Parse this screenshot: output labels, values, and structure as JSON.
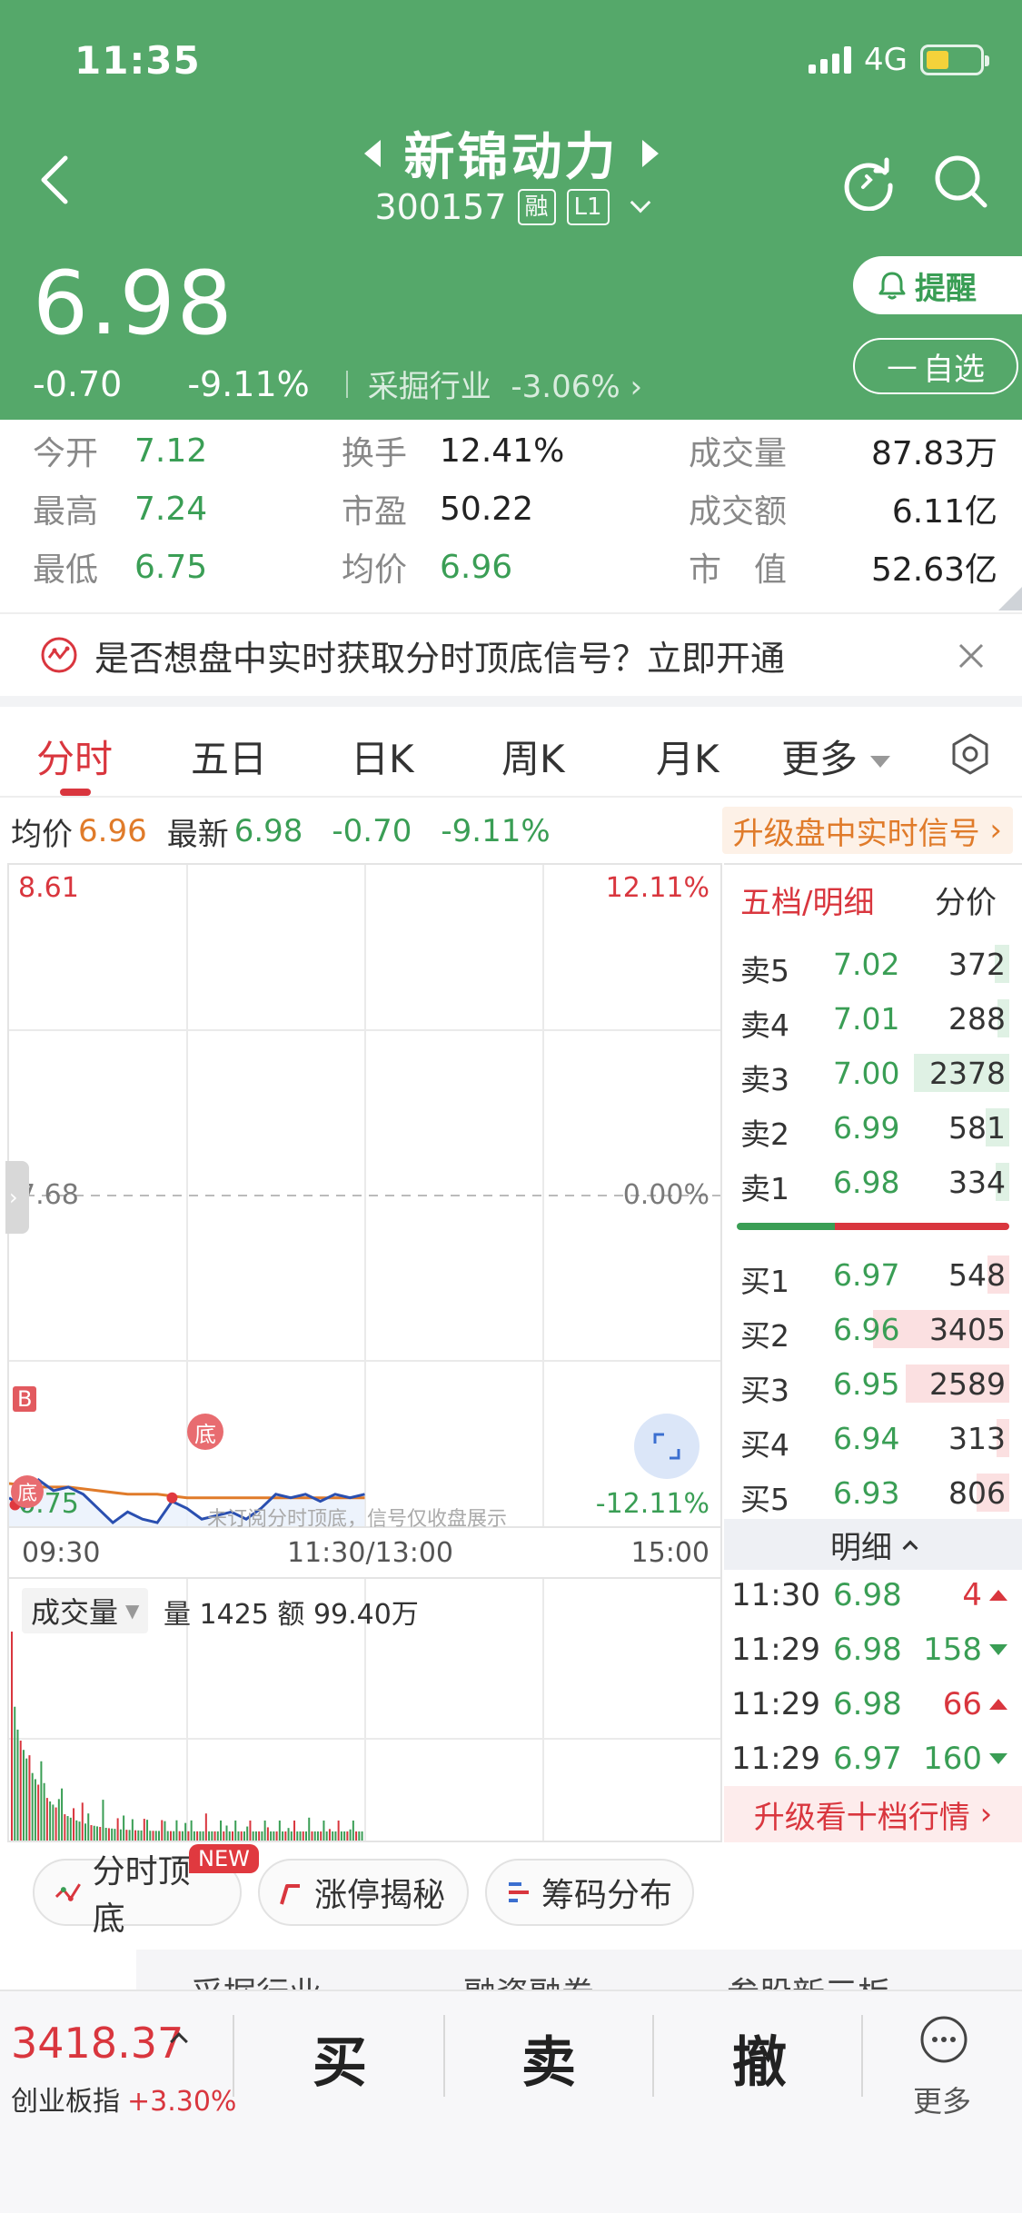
{
  "status_bar": {
    "time": "11:35",
    "network": "4G"
  },
  "header": {
    "name": "新锦动力",
    "code": "300157",
    "tag_margin": "融",
    "tag_level": "L1",
    "price": "6.98",
    "change": "-0.70",
    "change_pct": "-9.11%",
    "industry": "采掘行业",
    "industry_change": "-3.06%",
    "remind_label": "提醒",
    "watchlist_label": "自选"
  },
  "quote": {
    "open_label": "今开",
    "open": "7.12",
    "high_label": "最高",
    "high": "7.24",
    "low_label": "最低",
    "low": "6.75",
    "turnover_label": "换手",
    "turnover": "12.41%",
    "pe_label": "市盈",
    "pe": "50.22",
    "avg_label": "均价",
    "avg": "6.96",
    "volume_label": "成交量",
    "volume": "87.83万",
    "amount_label": "成交额",
    "amount": "6.11亿",
    "mcap_label": "市　值",
    "mcap": "52.63亿"
  },
  "banner": {
    "text": "是否想盘中实时获取分时顶底信号？立即开通"
  },
  "tabs": [
    "分时",
    "五日",
    "日K",
    "周K",
    "月K",
    "更多"
  ],
  "info_row": {
    "avg_label": "均价",
    "avg": "6.96",
    "latest_label": "最新",
    "latest": "6.98",
    "change": "-0.70",
    "change_pct": "-9.11%",
    "upgrade": "升级盘中实时信号"
  },
  "chart": {
    "y_top": "8.61",
    "y_mid": "7.68",
    "y_bottom": "6.75",
    "pct_top": "12.11%",
    "pct_mid": "0.00%",
    "pct_bottom": "-12.11%",
    "time_start": "09:30",
    "time_mid": "11:30/13:00",
    "time_end": "15:00",
    "marker_buy": "B",
    "marker_bottom": "底",
    "watermark": "未订阅分时顶底，信号仅收盘展示",
    "volume_tag": "成交量",
    "volume_info": "量 1425   额 99.40万"
  },
  "chart_data": {
    "type": "line",
    "title": "",
    "x_range": [
      "09:30",
      "15:00"
    ],
    "ylim": [
      6.75,
      8.61
    ],
    "series": [
      {
        "x_minutes": [
          0,
          5,
          10,
          15,
          20,
          25,
          30,
          35,
          40,
          45,
          50,
          55,
          60,
          65,
          70,
          75,
          80,
          85,
          90,
          95,
          100,
          105,
          110,
          115,
          120
        ],
        "values": [
          6.83,
          6.8,
          6.88,
          6.85,
          6.86,
          6.84,
          6.8,
          6.76,
          6.79,
          6.77,
          6.76,
          6.82,
          6.8,
          6.77,
          6.78,
          6.79,
          6.77,
          6.8,
          6.84,
          6.83,
          6.84,
          6.82,
          6.84,
          6.83,
          6.84
        ]
      },
      {
        "x_minutes": [
          0,
          10,
          20,
          30,
          40,
          50,
          60,
          70,
          80,
          90,
          100,
          110,
          120
        ],
        "values": [
          6.87,
          6.86,
          6.86,
          6.85,
          6.84,
          6.84,
          6.83,
          6.83,
          6.83,
          6.83,
          6.83,
          6.83,
          6.83
        ]
      }
    ]
  },
  "order_book": {
    "title": "五档/明细",
    "price_tab": "分价",
    "asks": [
      {
        "label": "卖5",
        "price": "7.02",
        "vol": "372"
      },
      {
        "label": "卖4",
        "price": "7.01",
        "vol": "288"
      },
      {
        "label": "卖3",
        "price": "7.00",
        "vol": "2378"
      },
      {
        "label": "卖2",
        "price": "6.99",
        "vol": "581"
      },
      {
        "label": "卖1",
        "price": "6.98",
        "vol": "334"
      }
    ],
    "bids": [
      {
        "label": "买1",
        "price": "6.97",
        "vol": "548"
      },
      {
        "label": "买2",
        "price": "6.96",
        "vol": "3405"
      },
      {
        "label": "买3",
        "price": "6.95",
        "vol": "2589"
      },
      {
        "label": "买4",
        "price": "6.94",
        "vol": "313"
      },
      {
        "label": "买5",
        "price": "6.93",
        "vol": "806"
      }
    ],
    "detail_label": "明细",
    "ticks": [
      {
        "time": "11:30",
        "price": "6.98",
        "vol": "4",
        "dir": "up"
      },
      {
        "time": "11:29",
        "price": "6.98",
        "vol": "158",
        "dir": "down"
      },
      {
        "time": "11:29",
        "price": "6.98",
        "vol": "66",
        "dir": "up"
      },
      {
        "time": "11:29",
        "price": "6.97",
        "vol": "160",
        "dir": "down"
      }
    ],
    "upgrade": "升级看十档行情"
  },
  "features": {
    "chip1": "分时顶底",
    "chip1_badge": "NEW",
    "chip2": "涨停揭秘",
    "chip3": "筹码分布"
  },
  "peek": [
    "采掘行业",
    "融资融券",
    "参股新三板"
  ],
  "bottom": {
    "index_value": "3418.37",
    "index_name": "创业板指",
    "index_change": "+3.30%",
    "buy": "买",
    "sell": "卖",
    "cancel": "撤",
    "more": "更多"
  }
}
